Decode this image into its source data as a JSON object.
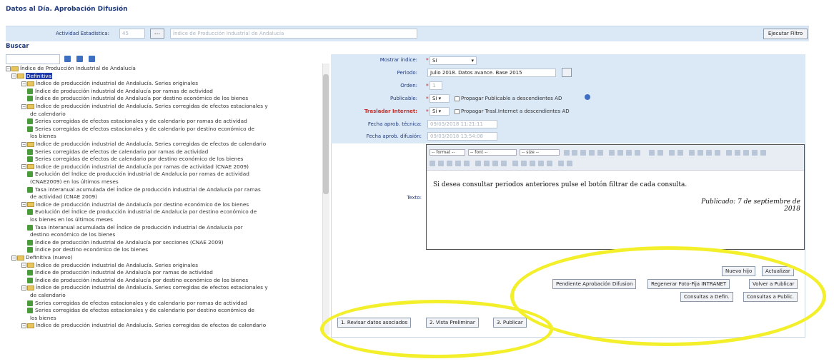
{
  "page": {
    "title": "Datos al Día. Aprobación Difusión"
  },
  "filter": {
    "activity_label": "Actividad Estadística:",
    "activity_code": "45",
    "activity_dots": "...",
    "activity_name": "Índice de Producción Industrial de Andalucía",
    "execute_label": "Ejecutar Filtro"
  },
  "search": {
    "title": "Buscar"
  },
  "tree": {
    "rows": [
      {
        "t": "Índice de Producción Industrial de Andalucía",
        "kind": "folder"
      },
      {
        "t": "Definitiva",
        "kind": "folder",
        "selected": true
      },
      {
        "t": "Índice de producción industrial de Andalucía. Series originales",
        "kind": "folder"
      },
      {
        "t": "Índice de producción industrial de Andalucía por ramas de actividad",
        "kind": "leaf"
      },
      {
        "t": "Índice de producción industrial de Andalucía por destino económico de los bienes",
        "kind": "leaf"
      },
      {
        "t": "Índice de producción industrial de Andalucía. Series corregidas de efectos estacionales y",
        "kind": "folder"
      },
      {
        "t": "de calendario",
        "kind": "cont"
      },
      {
        "t": "Series corregidas de efectos estacionales y de calendario por ramas de actividad",
        "kind": "leaf"
      },
      {
        "t": "Series corregidas de efectos estacionales y de calendario por destino económico de",
        "kind": "leaf"
      },
      {
        "t": "los bienes",
        "kind": "cont"
      },
      {
        "t": "Índice de producción industrial de Andalucía. Series corregidas de efectos de calendario",
        "kind": "folder"
      },
      {
        "t": "Series corregidas de efectos de calendario por ramas de actividad",
        "kind": "leaf"
      },
      {
        "t": "Series corregidas de efectos de calendario por destino económico de los bienes",
        "kind": "leaf"
      },
      {
        "t": "Índice de producción industrial de Andalucía por ramas de actividad (CNAE 2009)",
        "kind": "folder"
      },
      {
        "t": "Evolución del Índice de producción industrial de Andalucía por ramas de actividad",
        "kind": "leaf"
      },
      {
        "t": "(CNAE2009) en los últimos meses",
        "kind": "cont"
      },
      {
        "t": "Tasa interanual acumulada del Índice de producción industrial de Andalucía por ramas",
        "kind": "leaf"
      },
      {
        "t": "de actividad (CNAE 2009)",
        "kind": "cont"
      },
      {
        "t": "Índice de producción industrial de Andalucía por destino económico de los bienes",
        "kind": "folder"
      },
      {
        "t": "Evolución del Índice de producción industrial de Andalucía por destino económico de",
        "kind": "leaf"
      },
      {
        "t": "los bienes en los últimos meses",
        "kind": "cont"
      },
      {
        "t": "Tasa interanual acumulada del Índice de producción industrial de Andalucía por",
        "kind": "leaf"
      },
      {
        "t": "destino económico de los bienes",
        "kind": "cont"
      },
      {
        "t": "Índice de producción industrial de Andalucía por secciones (CNAE 2009)",
        "kind": "leaf"
      },
      {
        "t": "Índice por destino económico de los bienes",
        "kind": "leaf"
      },
      {
        "t": "Definitiva (nuevo)",
        "kind": "folder"
      },
      {
        "t": "Índice de producción industrial de Andalucía. Series originales",
        "kind": "folder"
      },
      {
        "t": "Índice de producción industrial de Andalucía por ramas de actividad",
        "kind": "leaf"
      },
      {
        "t": "Índice de producción industrial de Andalucía por destino económico de los bienes",
        "kind": "leaf"
      },
      {
        "t": "Índice de producción industrial de Andalucía. Series corregidas de efectos estacionales y",
        "kind": "folder"
      },
      {
        "t": "de calendario",
        "kind": "cont"
      },
      {
        "t": "Series corregidas de efectos estacionales y de calendario por ramas de actividad",
        "kind": "leaf"
      },
      {
        "t": "Series corregidas de efectos estacionales y de calendario por destino económico de",
        "kind": "leaf"
      },
      {
        "t": "los bienes",
        "kind": "cont"
      },
      {
        "t": "Índice de producción industrial de Andalucía. Series corregidas de efectos de calendario",
        "kind": "folder"
      }
    ]
  },
  "form": {
    "mostrar_label": "Mostrar índice:",
    "mostrar_value": "Sí",
    "periodo_label": "Periodo:",
    "periodo_value": "Julio 2018. Datos avance. Base 2015",
    "orden_label": "Orden:",
    "orden_value": "1",
    "publicable_label": "Publicable:",
    "publicable_value": "Sí",
    "propagar_publicable": "Propagar Publicable a descendientes AD",
    "trasladar_label": "Trasladar Internet:",
    "trasladar_value": "Sí",
    "propagar_trasl": "Propagar Trasl.Internet a descendientes AD",
    "fecha_tecnica_label": "Fecha aprob. técnica:",
    "fecha_tecnica_value": "09/03/2018 11:21:11",
    "fecha_difusion_label": "Fecha aprob. difusión:",
    "fecha_difusion_value": "09/03/2018 13:54:08",
    "texto_label": "Texto:",
    "required_mark": "*"
  },
  "editor": {
    "format_select": "-- format --",
    "font_select": "-- font --",
    "size_select": "-- size --",
    "text_line1": "Si desea consultar periodos anteriores pulse el botón filtrar de cada consulta.",
    "text_line2": "Publicado: 7 de septiembre de 2018"
  },
  "buttons": {
    "nuevo_hijo": "Nuevo hijo",
    "actualizar": "Actualizar",
    "pendiente": "Pendiente Aprobación Difusion",
    "regenerar": "Regenerar Foto-Fija INTRANET",
    "volver": "Volver a Publicar",
    "consultas_defin": "Consultas a Defin.",
    "consultas_public": "Consultas a Public.",
    "revisar": "1. Revisar datos asociados",
    "vista": "2. Vista Preliminar",
    "publicar": "3. Publicar"
  },
  "colors": {
    "accent": "#1f3a7a",
    "panel": "#dbe8f6",
    "highlight": "#f3ef2a",
    "required": "#c0302a"
  }
}
